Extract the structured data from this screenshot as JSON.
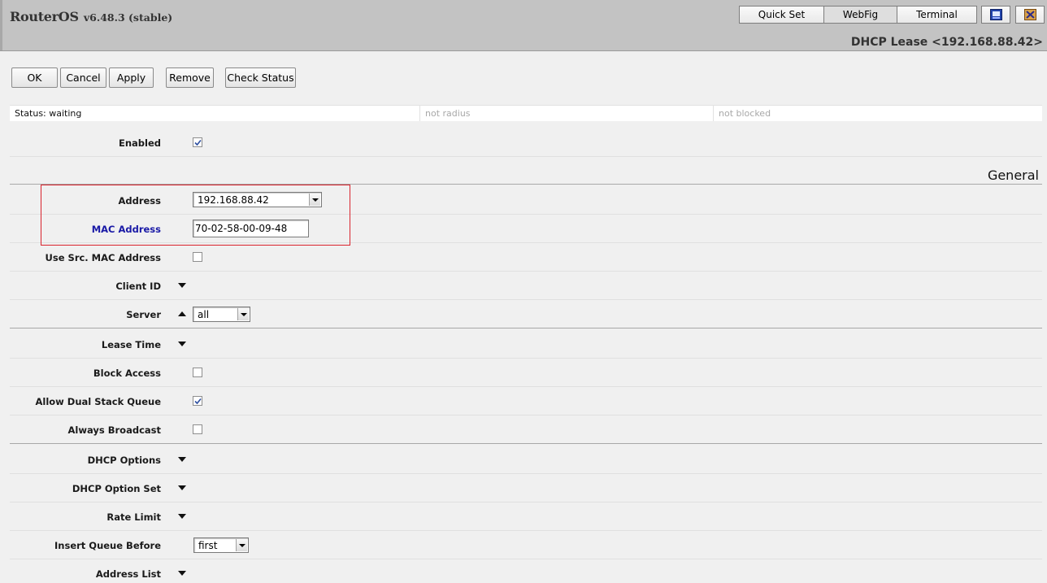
{
  "header": {
    "brand_name": "RouterOS",
    "brand_version": "v6.48.3 (stable)",
    "modes": [
      "Quick Set",
      "WebFig",
      "Terminal"
    ],
    "active_mode": "WebFig",
    "window_title": "DHCP Lease <192.168.88.42>"
  },
  "toolbar": {
    "ok": "OK",
    "cancel": "Cancel",
    "apply": "Apply",
    "remove": "Remove",
    "check_status": "Check Status"
  },
  "statusbar": {
    "status": "Status: waiting",
    "radius": "not radius",
    "blocked": "not blocked"
  },
  "form": {
    "enabled": {
      "label": "Enabled",
      "checked": true
    },
    "section_general": "General",
    "address": {
      "label": "Address",
      "value": "192.168.88.42"
    },
    "mac_address": {
      "label": "MAC Address",
      "value": "70-02-58-00-09-48"
    },
    "use_src_mac": {
      "label": "Use Src. MAC Address",
      "checked": false
    },
    "client_id": {
      "label": "Client ID"
    },
    "server": {
      "label": "Server",
      "value": "all"
    },
    "lease_time": {
      "label": "Lease Time"
    },
    "block_access": {
      "label": "Block Access",
      "checked": false
    },
    "allow_dual_stack_queue": {
      "label": "Allow Dual Stack Queue",
      "checked": true
    },
    "always_broadcast": {
      "label": "Always Broadcast",
      "checked": false
    },
    "dhcp_options": {
      "label": "DHCP Options"
    },
    "dhcp_option_set": {
      "label": "DHCP Option Set"
    },
    "rate_limit": {
      "label": "Rate Limit"
    },
    "insert_queue_before": {
      "label": "Insert Queue Before",
      "value": "first"
    },
    "address_list": {
      "label": "Address List"
    }
  },
  "colors": {
    "header_bg": "#c3c3c3",
    "page_bg": "#f0f0f0",
    "highlight_border": "#d9232d",
    "mac_label": "#1919a6"
  }
}
